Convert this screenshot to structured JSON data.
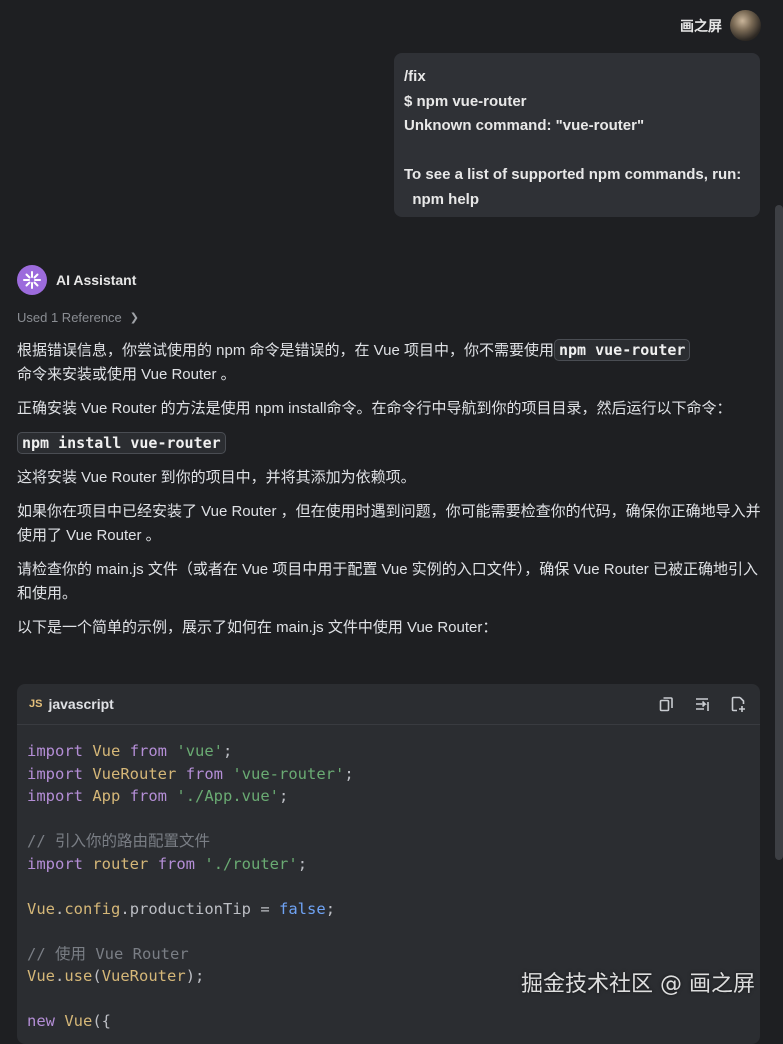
{
  "user": {
    "name": "画之屏",
    "message": "/fix\n$ npm vue-router\nUnknown command: \"vue-router\"\n\nTo see a list of supported npm commands, run:\n  npm help"
  },
  "assistant": {
    "name": "AI Assistant",
    "reference": "Used 1 Reference",
    "p1_before": "根据错误信息，你尝试使用的 npm 命令是错误的，在 Vue 项目中，你不需要使用",
    "p1_code": "npm vue-router",
    "p1_after": "命令来安装或使用 Vue Router 。",
    "p2": "正确安装 Vue Router 的方法是使用 npm install命令。在命令行中导航到你的项目目录，然后运行以下命令：",
    "install_cmd": "npm install vue-router",
    "p3": "这将安装 Vue Router 到你的项目中，并将其添加为依赖项。",
    "p4": "如果你在项目中已经安装了 Vue Router ，但在使用时遇到问题，你可能需要检查你的代码，确保你正确地导入并使用了 Vue Router 。",
    "p5": "请检查你的 main.js 文件（或者在 Vue 项目中用于配置 Vue 实例的入口文件），确保 Vue Router 已被正确地引入和使用。",
    "p6": "以下是一个简单的示例，展示了如何在 main.js 文件中使用 Vue Router："
  },
  "code": {
    "badge": "JS",
    "language": "javascript",
    "lines": {
      "l1a": "import",
      "l1b": "Vue",
      "l1c": "from",
      "l1d": "'vue'",
      "l2a": "import",
      "l2b": "VueRouter",
      "l2c": "from",
      "l2d": "'vue-router'",
      "l3a": "import",
      "l3b": "App",
      "l3c": "from",
      "l3d": "'./App.vue'",
      "c1": "// 引入你的路由配置文件",
      "l5a": "import",
      "l5b": "router",
      "l5c": "from",
      "l5d": "'./router'",
      "l6a": "Vue",
      "l6b": "config",
      "l6c": "productionTip",
      "l6d": "false",
      "c2": "// 使用 Vue Router",
      "l8a": "Vue",
      "l8b": "use",
      "l8c": "VueRouter",
      "l9a": "new",
      "l9b": "Vue"
    }
  },
  "watermark": "掘金技术社区 @ 画之屏"
}
